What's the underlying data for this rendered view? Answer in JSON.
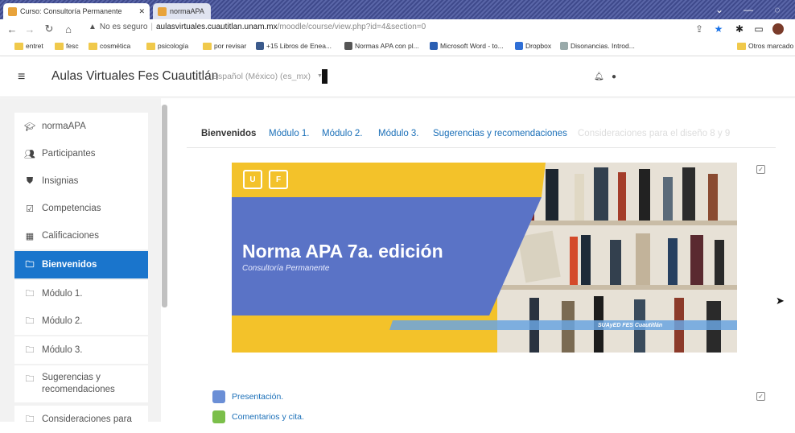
{
  "browser": {
    "tabs": [
      {
        "title": "Curso: Consultoría Permanente",
        "active": true
      },
      {
        "title": "normaAPA",
        "active": false
      }
    ],
    "security_label": "No es seguro",
    "url_host": "aulasvirtuales.cuautitlan.unam.mx",
    "url_path": "/moodle/course/view.php?id=4&section=0",
    "bookmarks": [
      {
        "label": "entret",
        "icon": "folder-icon"
      },
      {
        "label": "fesc",
        "icon": "folder-icon"
      },
      {
        "label": "cosmética",
        "icon": "folder-icon"
      },
      {
        "label": "psicología",
        "icon": "folder-icon"
      },
      {
        "label": "por revisar",
        "icon": "folder-icon"
      },
      {
        "label": "+15 Libros de Enea...",
        "icon": "bookmark-icon"
      },
      {
        "label": "Normas APA con pl...",
        "icon": "bookmark-icon"
      },
      {
        "label": "Microsoft Word - to...",
        "icon": "word-icon"
      },
      {
        "label": "Dropbox",
        "icon": "dropbox-icon"
      },
      {
        "label": "Disonancias. Introd...",
        "icon": "bookmark-icon"
      },
      {
        "label": "Otros marcado",
        "icon": "folder-icon"
      }
    ]
  },
  "navbar": {
    "site_name": "Aulas Virtuales Fes Cuautitlán",
    "language": "Español (México) (es_mx)"
  },
  "sidebar": {
    "items": [
      {
        "label": "normaAPA",
        "icon": "graduation-cap-icon",
        "active": false
      },
      {
        "label": "Participantes",
        "icon": "users-icon",
        "active": false
      },
      {
        "label": "Insignias",
        "icon": "shield-icon",
        "active": false
      },
      {
        "label": "Competencias",
        "icon": "checkbox-icon",
        "active": false
      },
      {
        "label": "Calificaciones",
        "icon": "table-icon",
        "active": false
      },
      {
        "label": "Bienvenidos",
        "icon": "folder-icon",
        "active": true
      },
      {
        "label": "Módulo 1.",
        "icon": "folder-icon",
        "active": false
      },
      {
        "label": "Módulo 2.",
        "icon": "folder-icon",
        "active": false
      },
      {
        "label": "Módulo 3.",
        "icon": "folder-icon",
        "active": false
      },
      {
        "label": "Sugerencias y recomendaciones",
        "icon": "folder-icon",
        "active": false
      },
      {
        "label": "Consideraciones para",
        "icon": "folder-icon",
        "active": false
      }
    ]
  },
  "course_tabs": [
    {
      "label": "Bienvenidos",
      "state": "active"
    },
    {
      "label": "Módulo 1.",
      "state": "link"
    },
    {
      "label": "Módulo 2.",
      "state": "link"
    },
    {
      "label": "Módulo 3.",
      "state": "link"
    },
    {
      "label": "Sugerencias y recomendaciones",
      "state": "link"
    },
    {
      "label": "Consideraciones para el diseño 8 y 9",
      "state": "faded"
    }
  ],
  "banner": {
    "title": "Norma APA 7a. edición",
    "subtitle": "Consultoría Permanente",
    "footer": "SUAyED FES Cuautitlán",
    "colors": {
      "yellow": "#f3c22a",
      "blue": "#5a73c6"
    }
  },
  "activities": [
    {
      "label": "Presentación.",
      "icon": "file-icon"
    },
    {
      "label": "Comentarios y cita.",
      "icon": "forum-icon"
    }
  ],
  "colors": {
    "accent": "#1a75cc",
    "link": "#1a6fb8"
  }
}
